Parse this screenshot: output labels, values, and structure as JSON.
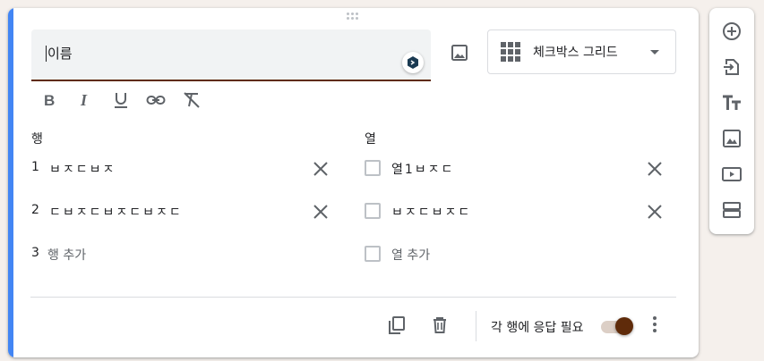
{
  "question": {
    "title_value": "이름",
    "type_label": "체크박스 그리드",
    "rows_label": "행",
    "columns_label": "열",
    "rows": [
      {
        "num": "1",
        "text": "ㅂㅈㄷㅂㅈ"
      },
      {
        "num": "2",
        "text": "ㄷㅂㅈㄷㅂㅈㄷㅂㅈㄷ"
      }
    ],
    "add_row": {
      "num": "3",
      "text": "행 추가"
    },
    "columns": [
      {
        "text": "열1ㅂㅈㄷ"
      },
      {
        "text": "ㅂㅈㄷㅂㅈㄷ"
      }
    ],
    "add_column": {
      "text": "열 추가"
    },
    "required_label": "각 행에 응답 필요",
    "required_on": true
  },
  "icons": {
    "format": [
      "bold-icon",
      "italic-icon",
      "underline-icon",
      "link-icon",
      "clear-format-icon"
    ],
    "side_toolbar": [
      "add-question-icon",
      "import-questions-icon",
      "add-title-icon",
      "add-image-icon",
      "add-video-icon",
      "add-section-icon"
    ],
    "footer": [
      "duplicate-icon",
      "delete-icon",
      "more-vert-icon"
    ]
  },
  "colors": {
    "accent": "#4285f4",
    "theme": "#5f2b0a",
    "icon": "#5f6368"
  }
}
